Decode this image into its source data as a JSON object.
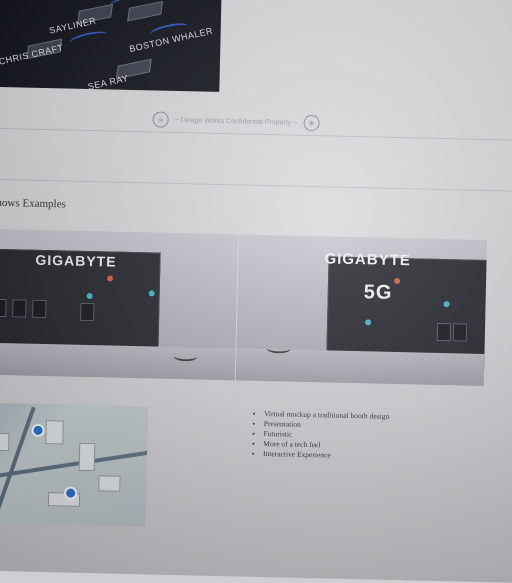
{
  "top_image": {
    "labels": [
      "SAYLINER",
      "BOSTON WHALER",
      "CHRIS CRAFT",
      "SEA RAY"
    ]
  },
  "footer": {
    "text": "~ Design Works Confidential Property ~"
  },
  "section": {
    "title": "e Shows Examples"
  },
  "booths": {
    "left_sign": "GIGABYTE",
    "right_sign": "GIGABYTE",
    "right_sub": "5G"
  },
  "bullets": [
    "Virtual mockup a traditional booth design",
    "Presentation",
    "Futuristic",
    "More of a tech feel",
    "Interactive Experience"
  ],
  "colors": {
    "accent_blue": "#2b55c9",
    "booth_teal": "#3fb6c8",
    "booth_red": "#d15a3a"
  }
}
